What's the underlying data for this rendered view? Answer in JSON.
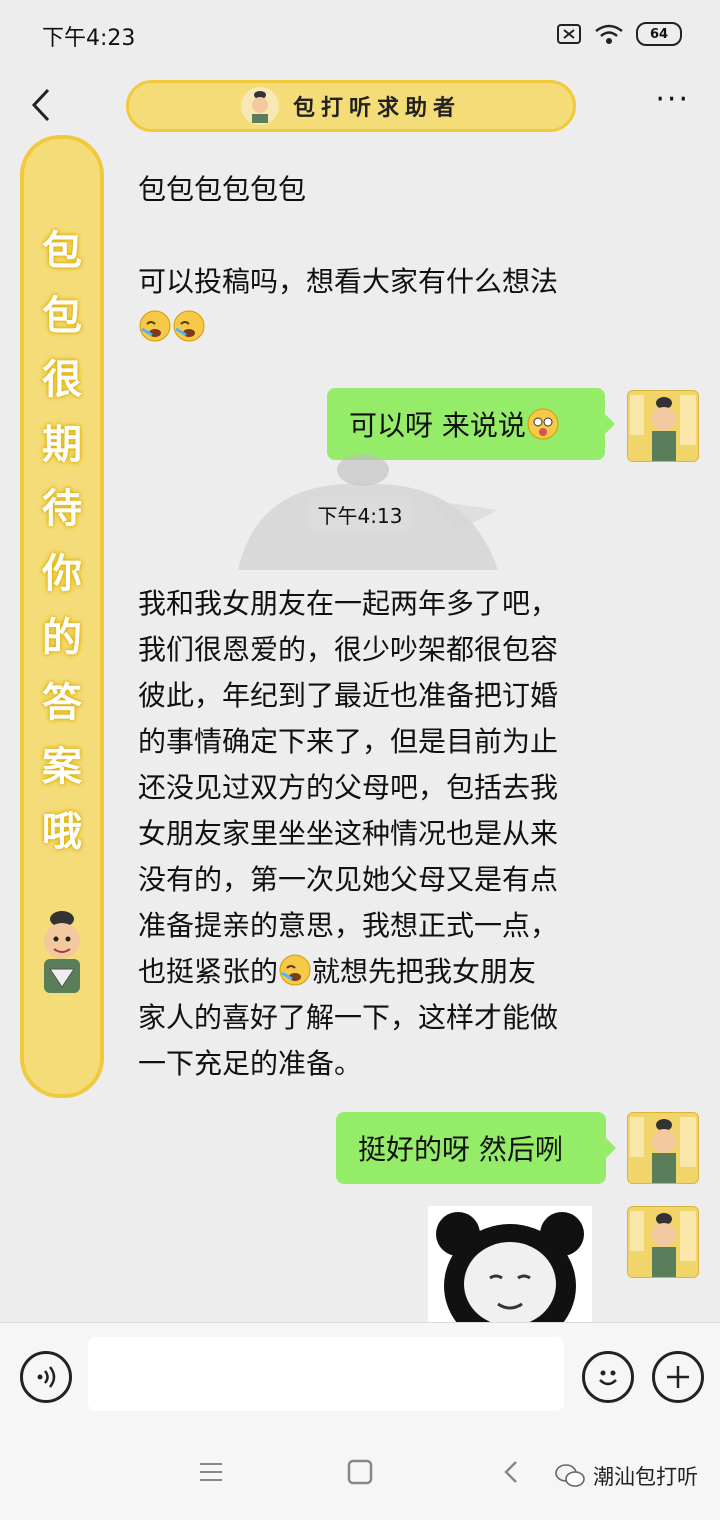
{
  "status_bar": {
    "time": "下午4:23",
    "battery": "64"
  },
  "header": {
    "title": "包打听求助者"
  },
  "decoration": {
    "vertical_text": [
      "包",
      "包",
      "很",
      "期",
      "待",
      "你",
      "的",
      "答",
      "案",
      "哦"
    ]
  },
  "messages": {
    "in1": {
      "line1": "包包包包包包",
      "line2": "可以投稿吗，想看大家有什么想法"
    },
    "out1": "可以呀 来说说",
    "timestamp": "下午4:13",
    "in2": {
      "lines": [
        "我和我女朋友在一起两年多了吧，",
        "我们很恩爱的，很少吵架都很包容",
        "彼此，年纪到了最近也准备把订婚",
        "的事情确定下来了，但是目前为止",
        "还没见过双方的父母吧，包括去我",
        "女朋友家里坐坐这种情况也是从来",
        "没有的，第一次见她父母又是有点",
        "准备提亲的意思，我想正式一点，",
        "也挺紧张的",
        "家人的喜好了解一下，这样才能做",
        "一下充足的准备。"
      ],
      "line9_after_emoji": "就想先把我女朋友"
    },
    "out2": "挺好的呀 然后咧"
  },
  "avatar_text": "包打听",
  "watermark": {
    "brand": "潮汕包打听"
  },
  "icons": {
    "back": "chevron-left-icon",
    "more": "more-dots-icon",
    "voice": "voice-icon",
    "emoji": "emoji-icon",
    "add": "plus-icon",
    "wifi": "wifi-icon",
    "sim": "sim-icon"
  },
  "colors": {
    "bubble_out": "#95ec69",
    "scroll": "#f4dc79",
    "background": "#ededed"
  }
}
